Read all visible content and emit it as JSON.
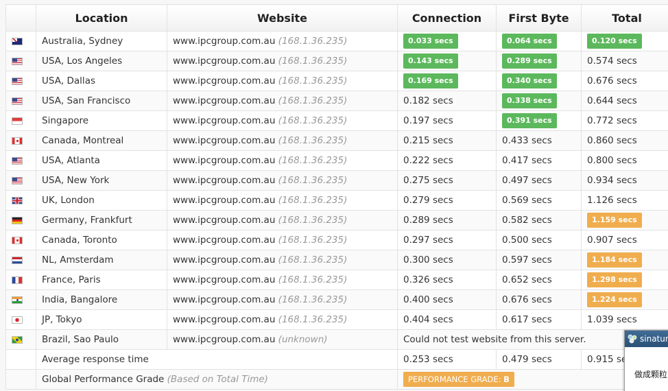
{
  "table": {
    "headers": [
      "Location",
      "Website",
      "Connection",
      "First Byte",
      "Total"
    ],
    "rows": [
      {
        "flag": "australia-flag-icon",
        "location": "Australia, Sydney",
        "website": "www.ipcgroup.com.au",
        "ip": "(168.1.36.235)",
        "connection": "0.033 secs",
        "first_byte": "0.064 secs",
        "total": "0.120 secs",
        "conn_badge": "green",
        "fb_badge": "green",
        "total_badge": "green"
      },
      {
        "flag": "usa-flag-icon",
        "location": "USA, Los Angeles",
        "website": "www.ipcgroup.com.au",
        "ip": "(168.1.36.235)",
        "connection": "0.143 secs",
        "first_byte": "0.289 secs",
        "total": "0.574 secs",
        "conn_badge": "green",
        "fb_badge": "green",
        "total_badge": ""
      },
      {
        "flag": "usa-flag-icon",
        "location": "USA, Dallas",
        "website": "www.ipcgroup.com.au",
        "ip": "(168.1.36.235)",
        "connection": "0.169 secs",
        "first_byte": "0.340 secs",
        "total": "0.676 secs",
        "conn_badge": "green",
        "fb_badge": "green",
        "total_badge": ""
      },
      {
        "flag": "usa-flag-icon",
        "location": "USA, San Francisco",
        "website": "www.ipcgroup.com.au",
        "ip": "(168.1.36.235)",
        "connection": "0.182 secs",
        "first_byte": "0.338 secs",
        "total": "0.644 secs",
        "conn_badge": "",
        "fb_badge": "green",
        "total_badge": ""
      },
      {
        "flag": "singapore-flag-icon",
        "location": "Singapore",
        "website": "www.ipcgroup.com.au",
        "ip": "(168.1.36.235)",
        "connection": "0.197 secs",
        "first_byte": "0.391 secs",
        "total": "0.772 secs",
        "conn_badge": "",
        "fb_badge": "green",
        "total_badge": ""
      },
      {
        "flag": "canada-flag-icon",
        "location": "Canada, Montreal",
        "website": "www.ipcgroup.com.au",
        "ip": "(168.1.36.235)",
        "connection": "0.215 secs",
        "first_byte": "0.433 secs",
        "total": "0.860 secs",
        "conn_badge": "",
        "fb_badge": "",
        "total_badge": ""
      },
      {
        "flag": "usa-flag-icon",
        "location": "USA, Atlanta",
        "website": "www.ipcgroup.com.au",
        "ip": "(168.1.36.235)",
        "connection": "0.222 secs",
        "first_byte": "0.417 secs",
        "total": "0.800 secs",
        "conn_badge": "",
        "fb_badge": "",
        "total_badge": ""
      },
      {
        "flag": "usa-flag-icon",
        "location": "USA, New York",
        "website": "www.ipcgroup.com.au",
        "ip": "(168.1.36.235)",
        "connection": "0.275 secs",
        "first_byte": "0.497 secs",
        "total": "0.934 secs",
        "conn_badge": "",
        "fb_badge": "",
        "total_badge": ""
      },
      {
        "flag": "uk-flag-icon",
        "location": "UK, London",
        "website": "www.ipcgroup.com.au",
        "ip": "(168.1.36.235)",
        "connection": "0.279 secs",
        "first_byte": "0.569 secs",
        "total": "1.126 secs",
        "conn_badge": "",
        "fb_badge": "",
        "total_badge": ""
      },
      {
        "flag": "germany-flag-icon",
        "location": "Germany, Frankfurt",
        "website": "www.ipcgroup.com.au",
        "ip": "(168.1.36.235)",
        "connection": "0.289 secs",
        "first_byte": "0.582 secs",
        "total": "1.159 secs",
        "conn_badge": "",
        "fb_badge": "",
        "total_badge": "orange"
      },
      {
        "flag": "canada-flag-icon",
        "location": "Canada, Toronto",
        "website": "www.ipcgroup.com.au",
        "ip": "(168.1.36.235)",
        "connection": "0.297 secs",
        "first_byte": "0.500 secs",
        "total": "0.907 secs",
        "conn_badge": "",
        "fb_badge": "",
        "total_badge": ""
      },
      {
        "flag": "netherlands-flag-icon",
        "location": "NL, Amsterdam",
        "website": "www.ipcgroup.com.au",
        "ip": "(168.1.36.235)",
        "connection": "0.300 secs",
        "first_byte": "0.597 secs",
        "total": "1.184 secs",
        "conn_badge": "",
        "fb_badge": "",
        "total_badge": "orange"
      },
      {
        "flag": "france-flag-icon",
        "location": "France, Paris",
        "website": "www.ipcgroup.com.au",
        "ip": "(168.1.36.235)",
        "connection": "0.326 secs",
        "first_byte": "0.652 secs",
        "total": "1.298 secs",
        "conn_badge": "",
        "fb_badge": "",
        "total_badge": "orange"
      },
      {
        "flag": "india-flag-icon",
        "location": "India, Bangalore",
        "website": "www.ipcgroup.com.au",
        "ip": "(168.1.36.235)",
        "connection": "0.400 secs",
        "first_byte": "0.676 secs",
        "total": "1.224 secs",
        "conn_badge": "",
        "fb_badge": "",
        "total_badge": "orange"
      },
      {
        "flag": "japan-flag-icon",
        "location": "JP, Tokyo",
        "website": "www.ipcgroup.com.au",
        "ip": "(168.1.36.235)",
        "connection": "0.404 secs",
        "first_byte": "0.617 secs",
        "total": "1.039 secs",
        "conn_badge": "",
        "fb_badge": "",
        "total_badge": ""
      }
    ],
    "brazil": {
      "flag": "brazil-flag-icon",
      "location": "Brazil, Sao Paulo",
      "website": "www.ipcgroup.com.au",
      "ip": "(unknown)",
      "message": "Could not test website from this server."
    },
    "average": {
      "label": "Average response time",
      "connection": "0.253 secs",
      "first_byte": "0.479 secs",
      "total": "0.915 secs"
    },
    "grade": {
      "label": "Global Performance Grade",
      "note": "(Based on Total Time)",
      "badge": "PERFORMANCE GRADE:",
      "value": "B"
    }
  },
  "popup": {
    "title": "sinatur",
    "body": "做成颗粒"
  },
  "colors": {
    "green_badge": "#5cb85c",
    "orange_badge": "#f0ad4e",
    "popup_header": "#2a5076"
  }
}
